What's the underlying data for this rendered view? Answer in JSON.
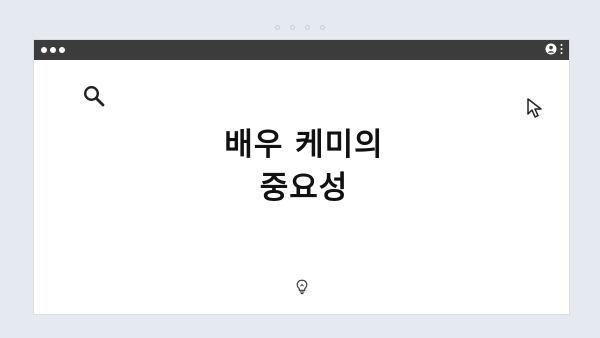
{
  "window": {
    "headline_line1": "배우 케미의",
    "headline_line2": "중요성"
  },
  "icons": {
    "pager": "pager-dots",
    "titlebar_left": "window-control-dots",
    "titlebar_user": "user-icon",
    "titlebar_menu": "more-vertical-icon",
    "search": "search-icon",
    "cursor": "cursor-icon",
    "idea": "lightbulb-icon"
  },
  "colors": {
    "background": "#e4eaef",
    "titlebar": "#3c3c3c",
    "window": "#ffffff",
    "text": "#111111"
  }
}
